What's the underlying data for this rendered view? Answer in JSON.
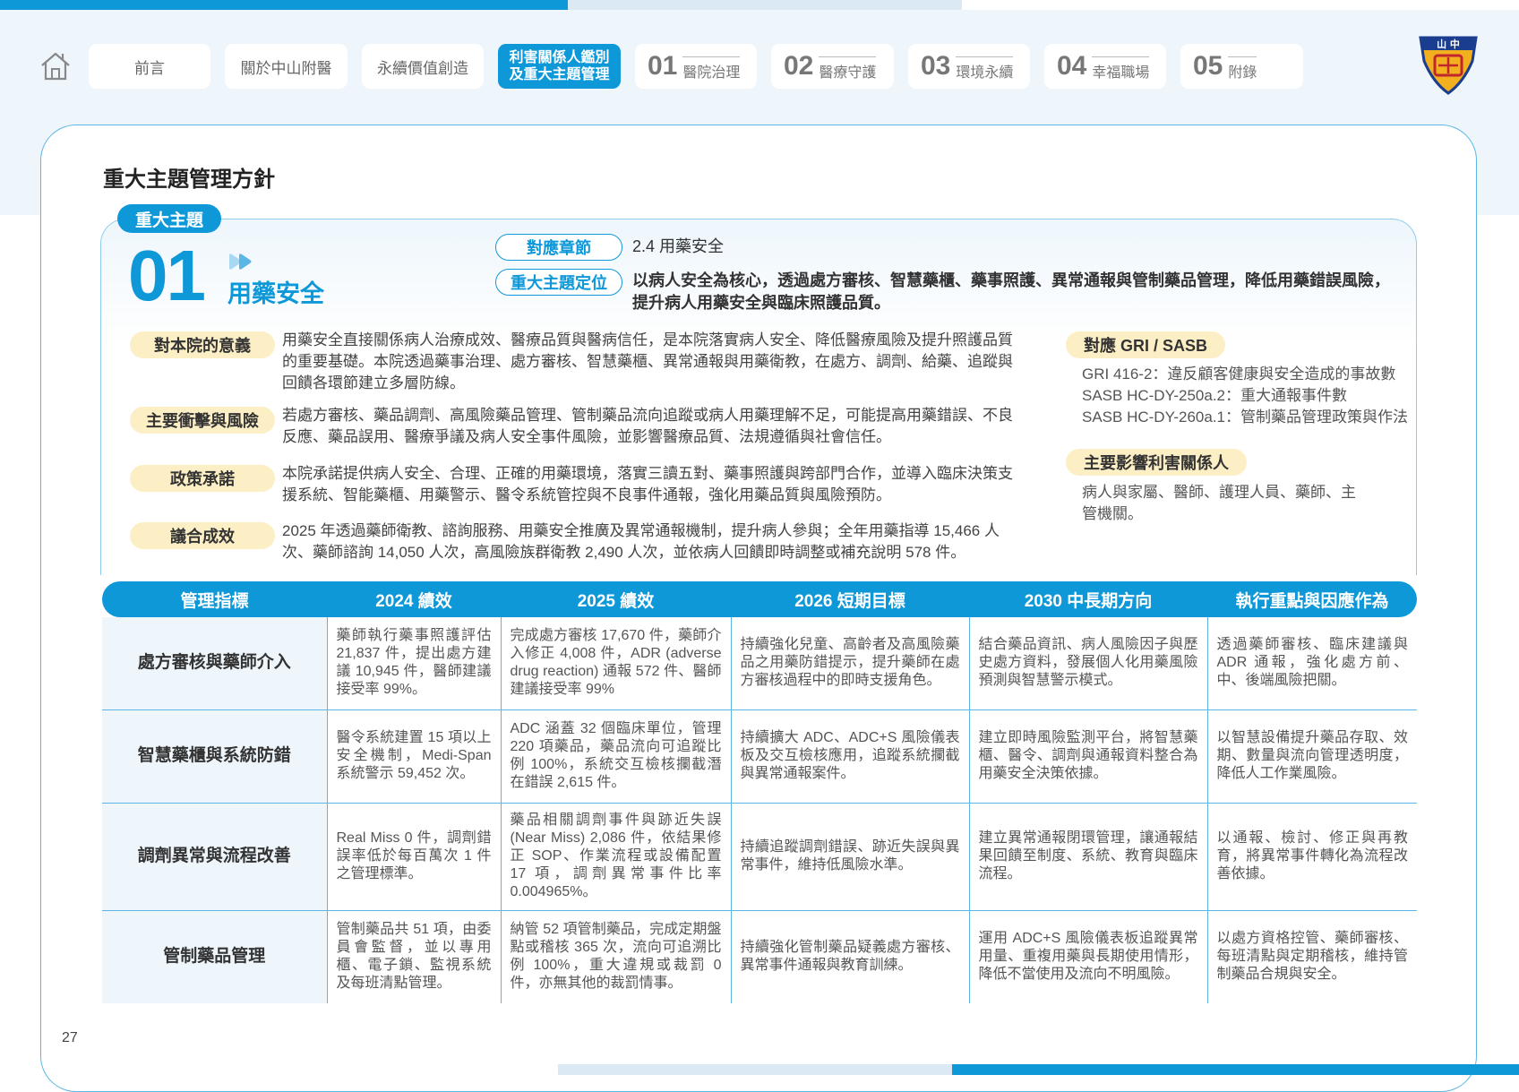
{
  "nav": {
    "tabs": [
      {
        "label": "前言"
      },
      {
        "label": "關於中山附醫"
      },
      {
        "label": "永續價值創造"
      },
      {
        "label": "利害關係人鑑別及重大主題管理"
      },
      {
        "num": "01",
        "label": "醫院治理"
      },
      {
        "num": "02",
        "label": "醫療守護"
      },
      {
        "num": "03",
        "label": "環境永續"
      },
      {
        "num": "04",
        "label": "幸福職場"
      },
      {
        "num": "05",
        "label": "附錄"
      }
    ],
    "active_line1": "利害關係人鑑別",
    "active_line2": "及重大主題管理",
    "logo_text": "山 中"
  },
  "section_title": "重大主題管理方針",
  "topic": {
    "tag": "重大主題",
    "number": "01",
    "name": "用藥安全",
    "chapter_label": "對應章節",
    "chapter_value": "2.4 用藥安全",
    "position_label": "重大主題定位",
    "position_value": "以病人安全為核心，透過處方審核、智慧藥櫃、藥事照護、異常通報與管制藥品管理，降低用藥錯誤風險，提升病人用藥安全與臨床照護品質。"
  },
  "items": [
    {
      "label": "對本院的意義",
      "text": "用藥安全直接關係病人治療成效、醫療品質與醫病信任，是本院落實病人安全、降低醫療風險及提升照護品質的重要基礎。本院透過藥事治理、處方審核、智慧藥櫃、異常通報與用藥衛教，在處方、調劑、給藥、追蹤與回饋各環節建立多層防線。"
    },
    {
      "label": "主要衝擊與風險",
      "text": "若處方審核、藥品調劑、高風險藥品管理、管制藥品流向追蹤或病人用藥理解不足，可能提高用藥錯誤、不良反應、藥品誤用、醫療爭議及病人安全事件風險，並影響醫療品質、法規遵循與社會信任。"
    },
    {
      "label": "政策承諾",
      "text": "本院承諾提供病人安全、合理、正確的用藥環境，落實三讀五對、藥事照護與跨部門合作，並導入臨床決策支援系統、智能藥櫃、用藥警示、醫令系統管控與不良事件通報，強化用藥品質與風險預防。"
    },
    {
      "label": "議合成效",
      "text": "2025 年透過藥師衛教、諮詢服務、用藥安全推廣及異常通報機制，提升病人參與；全年用藥指導 15,466 人次、藥師諮詢 14,050 人次，高風險族群衛教 2,490 人次，並依病人回饋即時調整或補充說明 578 件。"
    }
  ],
  "gri": {
    "label": "對應 GRI / SASB",
    "lines": [
      "GRI 416-2：違反顧客健康與安全造成的事故數",
      "SASB HC-DY-250a.2：重大通報事件數",
      "SASB HC-DY-260a.1：管制藥品管理政策與作法"
    ]
  },
  "stakeholders": {
    "label": "主要影響利害關係人",
    "text": "病人與家屬、醫師、護理人員、藥師、主管機關。"
  },
  "table": {
    "headers": [
      "管理指標",
      "2024 績效",
      "2025 績效",
      "2026 短期目標",
      "2030 中長期方向",
      "執行重點與因應作為"
    ],
    "rows": [
      [
        "處方審核與藥師介入",
        "藥師執行藥事照護評估 21,837 件，提出處方建議 10,945 件，醫師建議接受率 99%。",
        "完成處方審核 17,670 件，藥師介入修正 4,008 件，ADR (adverse drug reaction) 通報 572 件、醫師建議接受率 99%",
        "持續強化兒童、高齡者及高風險藥品之用藥防錯提示，提升藥師在處方審核過程中的即時支援角色。",
        "結合藥品資訊、病人風險因子與歷史處方資料，發展個人化用藥風險預測與智慧警示模式。",
        "透過藥師審核、臨床建議與 ADR 通報，強化處方前、中、後端風險把關。"
      ],
      [
        "智慧藥櫃與系統防錯",
        "醫令系統建置 15 項以上安全機制，Medi-Span 系統警示 59,452 次。",
        "ADC 涵蓋 32 個臨床單位，管理 220 項藥品，藥品流向可追蹤比例 100%，系統交互檢核攔截潛在錯誤 2,615 件。",
        "持續擴大 ADC、ADC+S 風險儀表板及交互檢核應用，追蹤系統攔截與異常通報案件。",
        "建立即時風險監測平台，將智慧藥櫃、醫令、調劑與通報資料整合為用藥安全決策依據。",
        "以智慧設備提升藥品存取、效期、數量與流向管理透明度，降低人工作業風險。"
      ],
      [
        "調劑異常與流程改善",
        "Real Miss 0 件，調劑錯誤率低於每百萬次 1 件之管理標準。",
        "藥品相關調劑事件與跡近失誤 (Near Miss) 2,086 件，依結果修正 SOP、作業流程或設備配置 17 項，調劑異常事件比率 0.004965%。",
        "持續追蹤調劑錯誤、跡近失誤與異常事件，維持低風險水準。",
        "建立異常通報閉環管理，讓通報結果回饋至制度、系統、教育與臨床流程。",
        "以通報、檢討、修正與再教育，將異常事件轉化為流程改善依據。"
      ],
      [
        "管制藥品管理",
        "管制藥品共 51 項，由委員會監督，並以專用櫃、電子鎖、監視系統及每班清點管理。",
        "納管 52 項管制藥品，完成定期盤點或稽核 365 次，流向可追溯比例 100%，重大違規或裁罰 0 件，亦無其他的裁罰情事。",
        "持續強化管制藥品疑義處方審核、異常事件通報與教育訓練。",
        "運用 ADC+S 風險儀表板追蹤異常用量、重複用藥與長期使用情形，降低不當使用及流向不明風險。",
        "以處方資格控管、藥師審核、每班清點與定期稽核，維持管制藥品合規與安全。"
      ]
    ]
  },
  "page_number": "27",
  "colors": {
    "accent": "#0e98d8",
    "pill_yellow": "#fdefc5",
    "border": "#5bb6e6"
  }
}
